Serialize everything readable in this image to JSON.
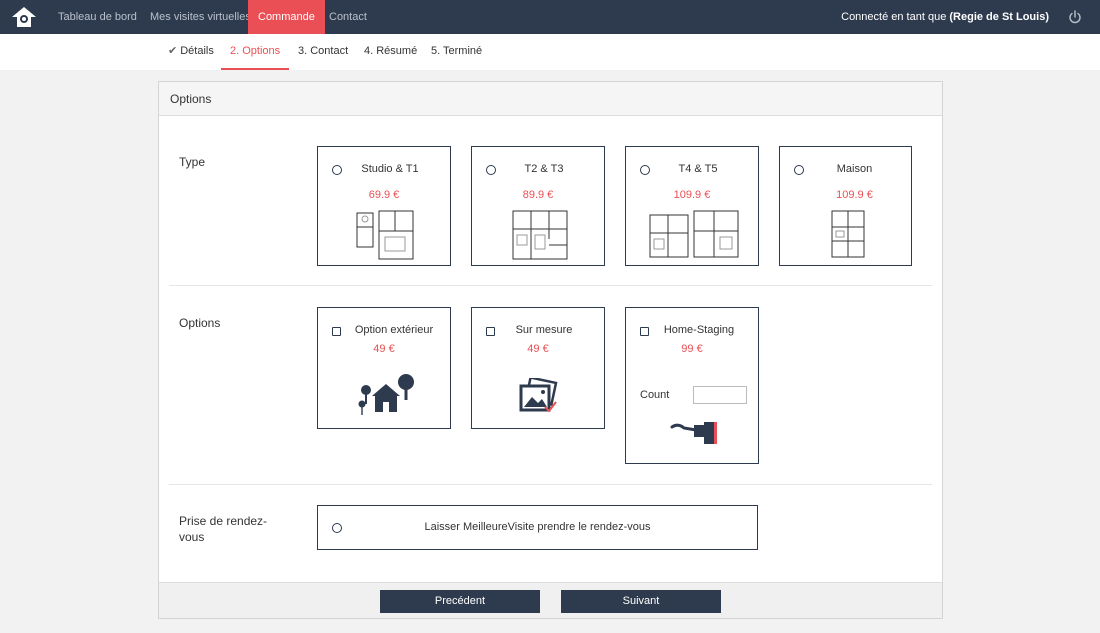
{
  "nav": {
    "links": [
      "Tableau de bord",
      "Mes visites virtuelles",
      "Commande",
      "Contact"
    ],
    "user_prefix": "Connecté en tant que ",
    "user_name": "(Regie de St Louis)"
  },
  "steps": [
    "Détails",
    "2. Options",
    "3. Contact",
    "4. Résumé",
    "5. Terminé"
  ],
  "panel": {
    "title": "Options"
  },
  "type_section": {
    "label": "Type",
    "cards": [
      {
        "title": "Studio & T1",
        "price": "69.9 €"
      },
      {
        "title": "T2 & T3",
        "price": "89.9 €"
      },
      {
        "title": "T4 & T5",
        "price": "109.9 €"
      },
      {
        "title": "Maison",
        "price": "109.9 €"
      }
    ]
  },
  "options_section": {
    "label": "Options",
    "cards": [
      {
        "title": "Option extérieur",
        "price": "49 €"
      },
      {
        "title": "Sur mesure",
        "price": "49 €"
      },
      {
        "title": "Home-Staging",
        "price": "99 €"
      }
    ],
    "count_label": "Count",
    "count_value": ""
  },
  "rdv_section": {
    "label": "Prise de rendez-vous",
    "option": "Laisser MeilleureVisite prendre le rendez-vous"
  },
  "buttons": {
    "previous": "Precédent",
    "next": "Suivant"
  },
  "colors": {
    "navbar": "#2e3b4e",
    "accent": "#e94f54"
  },
  "icons": [
    "logo-icon",
    "power-icon",
    "check-icon",
    "floorplan-icon",
    "house-trees-icon",
    "photo-frame-icon",
    "paint-brush-icon"
  ]
}
